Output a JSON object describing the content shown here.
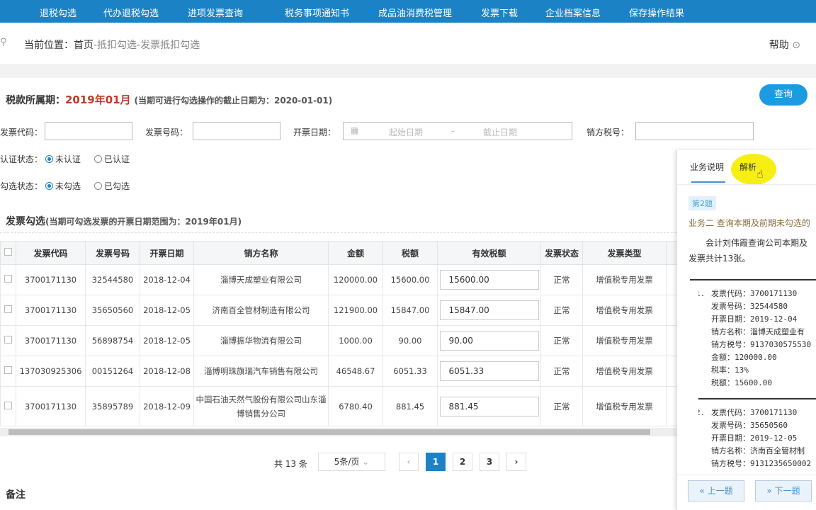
{
  "nav": {
    "items": [
      "退税勾选",
      "代办退税勾选",
      "进项发票查询",
      "税务事项通知书",
      "成品油消费税管理",
      "发票下载",
      "企业档案信息",
      "保存操作结果"
    ]
  },
  "breadcrumb": {
    "prefix": "当前位置：首页",
    "path": "-抵扣勾选-发票抵扣勾选",
    "help": "帮助"
  },
  "period": {
    "label": "税款所属期：",
    "value": "2019年01月",
    "note": "(当期可进行勾选操作的截止日期为：2020-01-01)",
    "query": "查询"
  },
  "filters": {
    "code_label": "发票代码：",
    "number_label": "发票号码：",
    "date_label": "开票日期：",
    "start_ph": "起始日期",
    "sep": "-",
    "end_ph": "截止日期",
    "tax_label": "销方税号：",
    "cert_label": "认证状态：",
    "cert_opts": [
      "未认证",
      "已认证"
    ],
    "sel_label": "勾选状态：",
    "sel_opts": [
      "未勾选",
      "已勾选"
    ]
  },
  "invoice_section": {
    "title": "发票勾选",
    "note": "(当期可勾选发票的开票日期范围为：2019年01月)"
  },
  "table": {
    "headers": [
      "发票代码",
      "发票号码",
      "开票日期",
      "销方名称",
      "金额",
      "税额",
      "有效税额",
      "发票状态",
      "发票类型"
    ],
    "rows": [
      [
        "3700171130",
        "32544580",
        "2018-12-04",
        "淄博天成塑业有限公司",
        "120000.00",
        "15600.00",
        "15600.00",
        "正常",
        "增值税专用发票"
      ],
      [
        "3700171130",
        "35650560",
        "2018-12-05",
        "济南百全管材制造有限公司",
        "121900.00",
        "15847.00",
        "15847.00",
        "正常",
        "增值税专用发票"
      ],
      [
        "3700171130",
        "56898754",
        "2018-12-05",
        "淄博振华物流有限公司",
        "1000.00",
        "90.00",
        "90.00",
        "正常",
        "增值税专用发票"
      ],
      [
        "137030925306",
        "00151264",
        "2018-12-08",
        "淄博明珠旗瑞汽车销售有限公司",
        "46548.67",
        "6051.33",
        "6051.33",
        "正常",
        "增值税专用发票"
      ],
      [
        "3700171130",
        "35895789",
        "2018-12-09",
        "中国石油天然气股份有限公司山东淄博销售分公司",
        "6780.40",
        "881.45",
        "881.45",
        "正常",
        "增值税专用发票"
      ]
    ]
  },
  "pagination": {
    "total": "共 13 条",
    "page_size": "5条/页",
    "pages": [
      "1",
      "2",
      "3"
    ],
    "current": "1"
  },
  "remarks": "备注",
  "panel": {
    "tabs": [
      "业务说明",
      "解析"
    ],
    "badge": "第2题",
    "title": "业务二 查询本期及前期未勾选的",
    "para": "会计刘伟霞查询公司本期及",
    "para2": "发票共计13张。",
    "items": [
      {
        "n": "1.",
        "lines": [
          "发票代码：3700171130",
          "发票号码：32544580",
          "开票日期：2019-12-04",
          "销方名称：淄博天成塑业有",
          "销方税号：91370305755З0",
          "金额：120000.00",
          "税率：13%",
          "税额：15600.00"
        ]
      },
      {
        "n": "2.",
        "lines": [
          "发票代码：3700171130",
          "发票号码：35650560",
          "开票日期：2019-12-05",
          "销方名称：济南百全管材制",
          "销方税号：9131235650002"
        ]
      }
    ],
    "prev": "« 上一题",
    "next": "» 下一题"
  }
}
